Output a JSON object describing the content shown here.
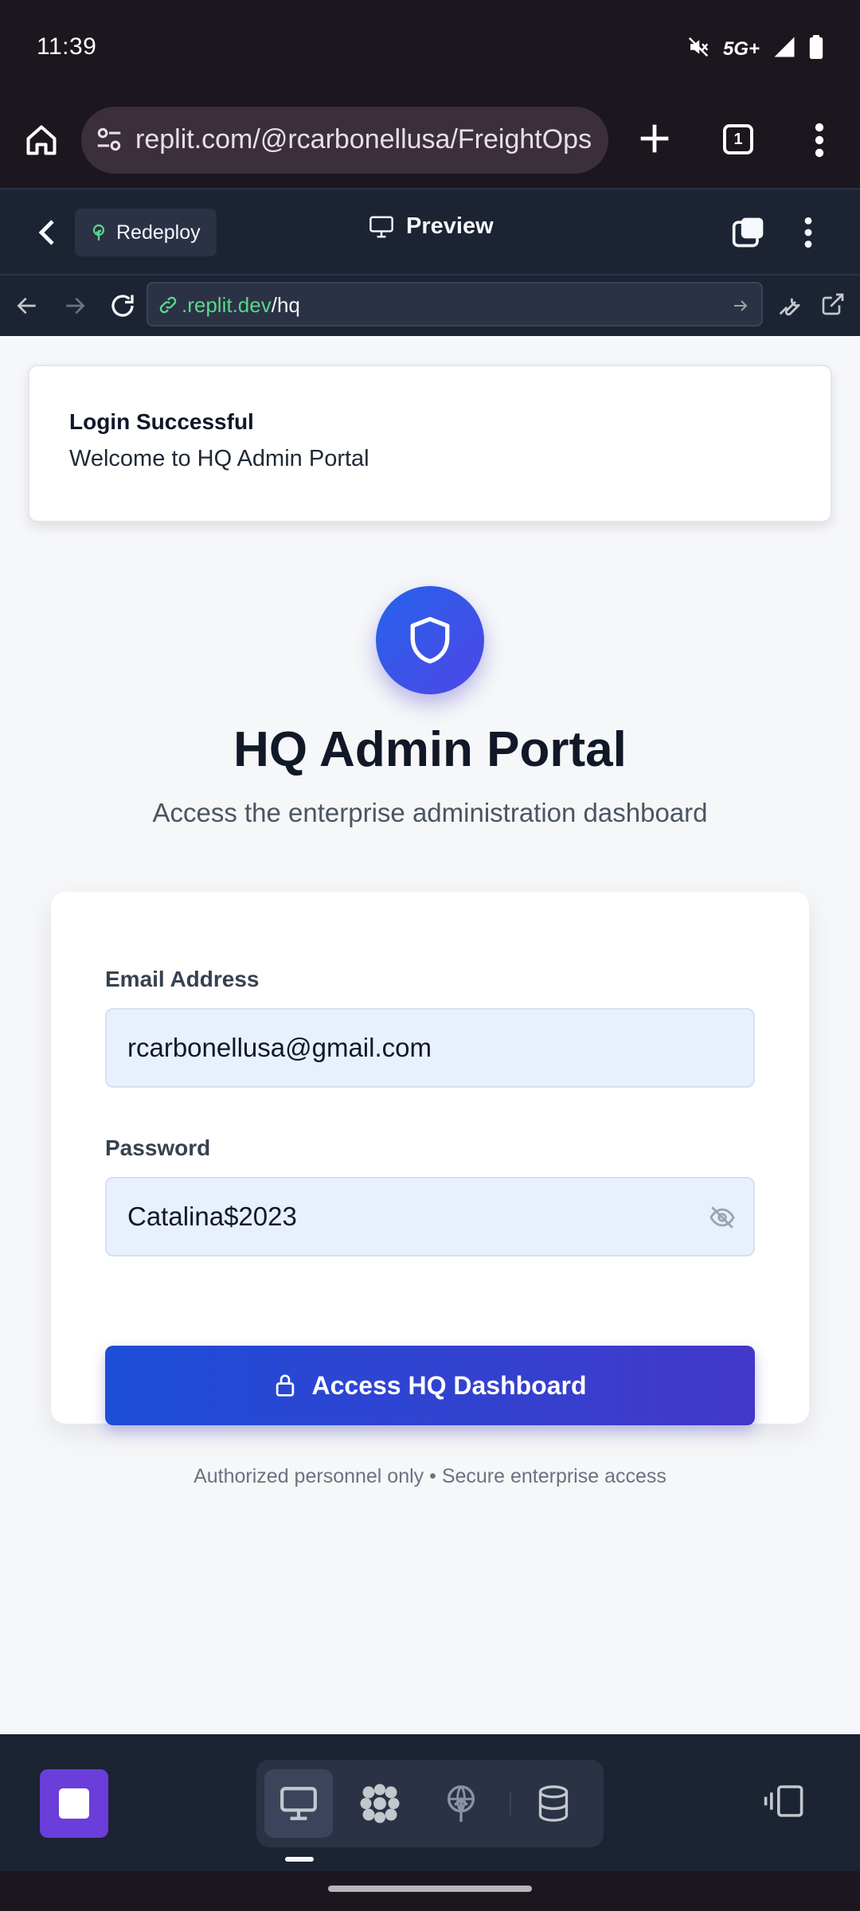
{
  "status_bar": {
    "time": "11:39",
    "network": "5G+",
    "icons": [
      "mute-icon",
      "signal-icon",
      "battery-icon"
    ]
  },
  "browser": {
    "url": "replit.com/@rcarbonellusa/FreightOps",
    "tab_count": "1"
  },
  "replit_header": {
    "redeploy_label": "Redeploy",
    "preview_label": "Preview"
  },
  "preview_url": {
    "host": ".replit.dev",
    "path": "/hq"
  },
  "toast": {
    "title": "Login Successful",
    "message": "Welcome to HQ Admin Portal"
  },
  "hero": {
    "icon": "shield-icon",
    "title": "HQ Admin Portal",
    "subtitle": "Access the enterprise administration dashboard"
  },
  "login_form": {
    "email_label": "Email Address",
    "email_value": "rcarbonellusa@gmail.com",
    "password_label": "Password",
    "password_value": "Catalina$2023",
    "submit_label": "Access HQ Dashboard",
    "footer_note": "Authorized personnel only • Secure enterprise access"
  },
  "bottom_bar": {
    "tabs": [
      "preview-icon",
      "workspace-icon",
      "deploy-icon",
      "database-icon"
    ],
    "active_tab": "preview-icon"
  },
  "colors": {
    "accent_gradient_start": "#1d4ed8",
    "accent_gradient_end": "#4338ca",
    "replit_bg": "#1c2333",
    "replit_link": "#5bd68a",
    "stop_button": "#6b3ddb"
  }
}
